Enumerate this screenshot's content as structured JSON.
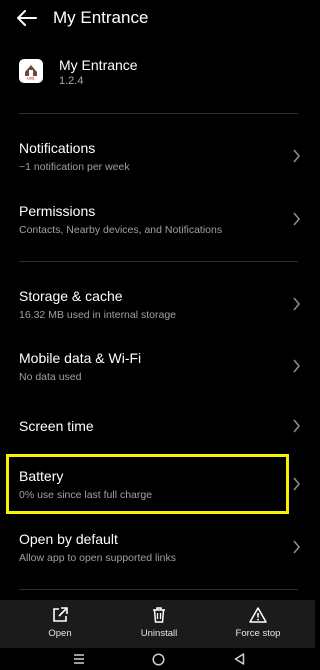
{
  "header": {
    "title": "My Entrance",
    "back_icon": "arrow-left-icon"
  },
  "app": {
    "name": "My Entrance",
    "version": "1.2.4",
    "icon": "lixil-app-icon",
    "icon_text": "LIXIL"
  },
  "settings": [
    {
      "title": "Notifications",
      "subtitle": "~1 notification per week"
    },
    {
      "title": "Permissions",
      "subtitle": "Contacts, Nearby devices, and Notifications"
    },
    {
      "title": "Storage & cache",
      "subtitle": "16.32 MB used in internal storage"
    },
    {
      "title": "Mobile data & Wi-Fi",
      "subtitle": "No data used"
    },
    {
      "title": "Screen time",
      "subtitle": ""
    },
    {
      "title": "Battery",
      "subtitle": "0% use since last full charge"
    },
    {
      "title": "Open by default",
      "subtitle": "Allow app to open supported links"
    }
  ],
  "actions": [
    {
      "label": "Open",
      "icon": "open-external-icon"
    },
    {
      "label": "Uninstall",
      "icon": "trash-icon"
    },
    {
      "label": "Force stop",
      "icon": "warning-triangle-icon"
    }
  ],
  "colors": {
    "background": "#000000",
    "highlight": "#f4f400",
    "bottom_bar": "#1b1b1b",
    "subtitle": "#a0a0a0"
  }
}
